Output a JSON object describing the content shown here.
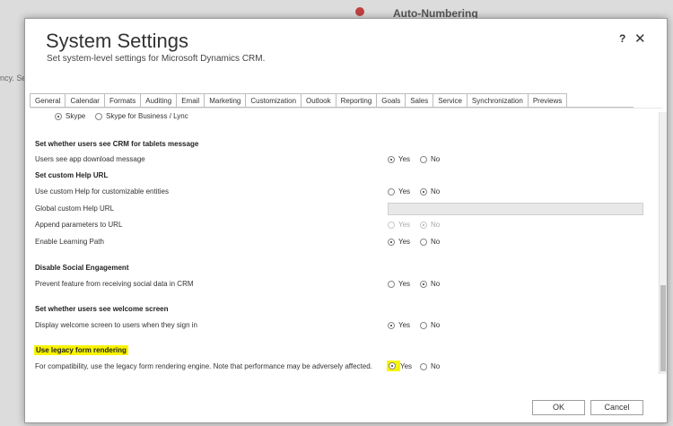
{
  "background": {
    "app_title": "Auto-Numbering",
    "left_fragment": "ncy. Se"
  },
  "dialog": {
    "title": "System Settings",
    "subtitle": "Set system-level settings for Microsoft Dynamics CRM.",
    "help_label": "?",
    "close_label": "✕"
  },
  "tabs": [
    "General",
    "Calendar",
    "Formats",
    "Auditing",
    "Email",
    "Marketing",
    "Customization",
    "Outlook",
    "Reporting",
    "Goals",
    "Sales",
    "Service",
    "Synchronization",
    "Previews"
  ],
  "active_tab": "General",
  "settings": {
    "skype": {
      "skype_label": "Skype",
      "lync_label": "Skype for Business / Lync",
      "selected": "Skype"
    },
    "tablet_message": {
      "header": "Set whether users see CRM for tablets message",
      "row_label": "Users see app download message",
      "yes": "Yes",
      "no": "No",
      "selected": "Yes"
    },
    "custom_help": {
      "header": "Set custom Help URL",
      "use_custom_label": "Use custom Help for customizable entities",
      "use_custom_selected": "No",
      "global_url_label": "Global custom Help URL",
      "global_url_value": "",
      "append_label": "Append parameters to URL",
      "append_selected": "No",
      "learning_label": "Enable Learning Path",
      "learning_selected": "Yes",
      "yes": "Yes",
      "no": "No"
    },
    "social": {
      "header": "Disable Social Engagement",
      "row_label": "Prevent feature from receiving social data in CRM",
      "yes": "Yes",
      "no": "No",
      "selected": "No"
    },
    "welcome": {
      "header": "Set whether users see welcome screen",
      "row_label": "Display welcome screen to users when they sign in",
      "yes": "Yes",
      "no": "No",
      "selected": "Yes"
    },
    "legacy": {
      "header": "Use legacy form rendering",
      "row_label": "For compatibility, use the legacy form rendering engine. Note that performance may be adversely affected.",
      "yes": "Yes",
      "no": "No",
      "selected": "Yes"
    }
  },
  "buttons": {
    "ok": "OK",
    "cancel": "Cancel"
  },
  "colors": {
    "highlight": "#f8f400"
  }
}
